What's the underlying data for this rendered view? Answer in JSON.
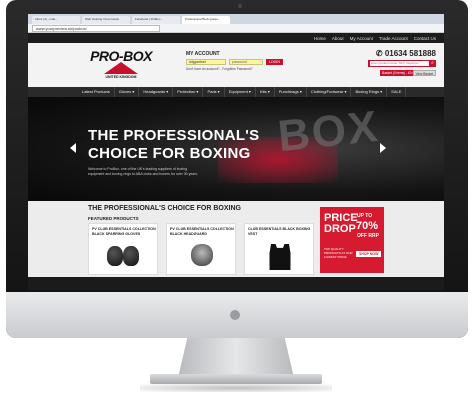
{
  "browser": {
    "tabs": [
      "Inbox (4) - mail...",
      "Web Hosting Yours Hosts",
      "Facebook | ProBox...",
      "Professional Boxing Equ..."
    ],
    "active_tab": 3,
    "address": "www.yourpreview.uk/probox/"
  },
  "topnav": [
    "Home",
    "About",
    "My Account",
    "Trade Account",
    "Contact Us"
  ],
  "header": {
    "logo": "PRO-BOX",
    "logo_sub": "UNITED KINGDOM",
    "account_title": "MY ACCOUNT",
    "account_user": "ddgpartner",
    "account_pass": "password",
    "login_label": "LOGIN",
    "account_links": "Don't have an account? - Forgotten Password?",
    "phone": "01634 581888",
    "search_placeholder": "enter product name, SKU, keyword...",
    "basket": "Basket (0 items) - £0.00",
    "view_basket": "View Basket"
  },
  "catnav": [
    "Latest Products",
    "Gloves ▾",
    "Headguards ▾",
    "Protection ▾",
    "Pads ▾",
    "Equipment ▾",
    "Kits ▾",
    "Punchbags ▾",
    "Clothing/Footwear ▾",
    "Boxing Rings ▾",
    "SALE"
  ],
  "hero": {
    "title_line1": "THE PROFESSIONAL'S",
    "title_line2": "CHOICE FOR BOXING",
    "copy": "Welcome to ProBox, one of the UK's leading suppliers of boxing equipment and boxing rings to ABA clubs and boxers for over 30 years.",
    "bg_text": "BOX"
  },
  "lower": {
    "title": "THE PROFESSIONAL'S CHOICE FOR BOXING",
    "featured": "FEATURED PRODUCTS",
    "products": [
      {
        "name": "PV CLUB ESSENTIALS COLLECTION BLACK SPARRING GLOVES"
      },
      {
        "name": "PV CLUB ESSENTIALS COLLECTION BLACK HEADGUARD"
      },
      {
        "name": "CLUB ESSENTIALS BLACK BOXING VEST"
      }
    ]
  },
  "promo": {
    "price_drop": "PRICE DROP",
    "up_to": "UP TO",
    "percent": "70%",
    "off": "OFF RRP",
    "note": "TOP QUALITY PRODUCTS AT OUR LOWEST PRICE",
    "shop": "SHOP NOW"
  },
  "colors": {
    "accent": "#c8102e",
    "dark": "#1b1b1b"
  }
}
